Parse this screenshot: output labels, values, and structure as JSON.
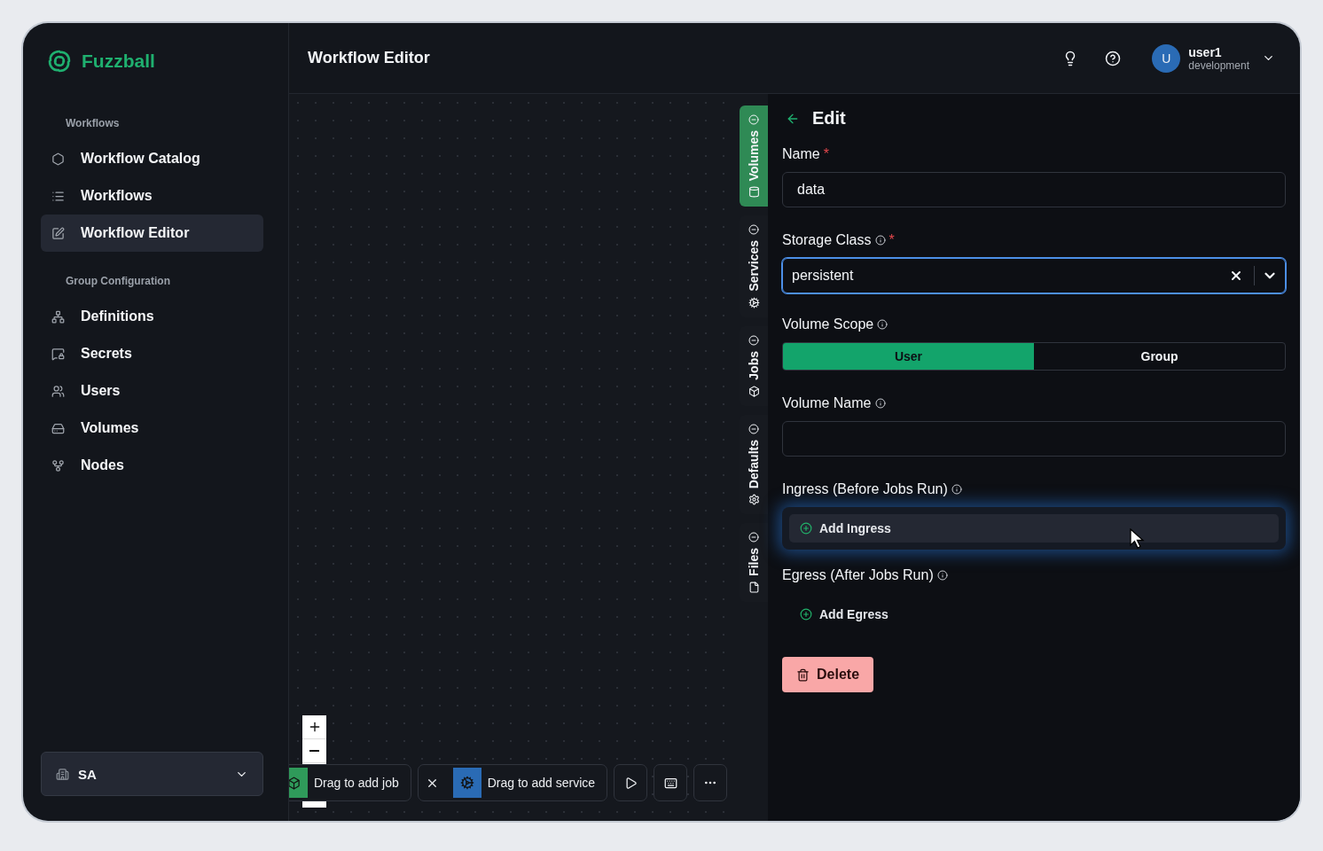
{
  "app": {
    "name": "Fuzzball"
  },
  "sidebar": {
    "sections": [
      {
        "title": "Workflows",
        "items": [
          {
            "label": "Workflow Catalog",
            "selected": false
          },
          {
            "label": "Workflows",
            "selected": false
          },
          {
            "label": "Workflow Editor",
            "selected": true
          }
        ]
      },
      {
        "title": "Group Configuration",
        "items": [
          {
            "label": "Definitions",
            "selected": false
          },
          {
            "label": "Secrets",
            "selected": false
          },
          {
            "label": "Users",
            "selected": false
          },
          {
            "label": "Volumes",
            "selected": false
          },
          {
            "label": "Nodes",
            "selected": false
          }
        ]
      }
    ],
    "org_switcher": {
      "label": "SA"
    }
  },
  "header": {
    "title": "Workflow Editor",
    "user": {
      "initial": "U",
      "name": "user1",
      "role": "development"
    }
  },
  "canvas": {
    "toolbar": [
      {
        "kind": "job",
        "label": "Drag to add job"
      },
      {
        "kind": "service",
        "label": "Drag to add service"
      },
      {
        "kind": "run"
      },
      {
        "kind": "keyboard"
      },
      {
        "kind": "more"
      }
    ]
  },
  "side_tabs": [
    {
      "label": "Volumes",
      "selected": true
    },
    {
      "label": "Services",
      "selected": false
    },
    {
      "label": "Jobs",
      "selected": false
    },
    {
      "label": "Defaults",
      "selected": false
    },
    {
      "label": "Files",
      "selected": false
    }
  ],
  "editor": {
    "title": "Edit",
    "fields": [
      {
        "kind": "text",
        "label": "Name",
        "info": false,
        "required_mark": "*",
        "value": "data",
        "focused": false
      },
      {
        "kind": "select",
        "label": "Storage Class",
        "info": true,
        "required_mark": "*",
        "value": "persistent",
        "focused": true
      },
      {
        "kind": "segmented",
        "label": "Volume Scope",
        "info": true,
        "options": [
          {
            "label": "User",
            "selected": true
          },
          {
            "label": "Group",
            "selected": false
          }
        ]
      },
      {
        "kind": "text",
        "label": "Volume Name",
        "info": true,
        "focused": false
      },
      {
        "kind": "list",
        "label": "Ingress (Before Jobs Run)",
        "info": true,
        "action": "Add Ingress",
        "highlighted": true
      },
      {
        "kind": "list",
        "label": "Egress (After Jobs Run)",
        "info": true,
        "action": "Add Egress",
        "highlighted": false
      }
    ],
    "delete_label": "Delete"
  }
}
